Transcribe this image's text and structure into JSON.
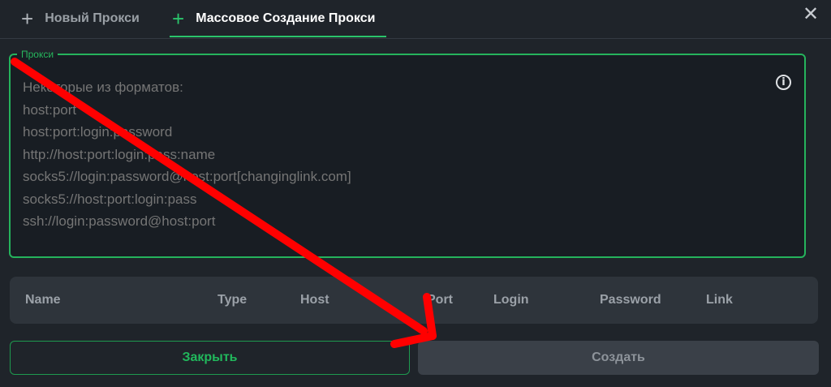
{
  "tabs": [
    {
      "label": "Новый Прокси",
      "icon": "plus-icon",
      "active": false
    },
    {
      "label": "Массовое Создание Прокси",
      "icon": "plus-icon",
      "active": true
    }
  ],
  "close_icon": "close-icon",
  "proxy_field": {
    "legend": "Прокси",
    "placeholder": "Некоторые из форматов:\nhost:port\nhost:port:login:password\nhttp://host:port:login:pass:name\nsocks5://login:password@host:port[changinglink.com]\nsocks5://host:port:login:pass\nssh://login:password@host:port",
    "value": "",
    "info_icon": "info-icon"
  },
  "table": {
    "columns": [
      "Name",
      "Type",
      "Host",
      "Port",
      "Login",
      "Password",
      "Link"
    ]
  },
  "buttons": {
    "close_label": "Закрыть",
    "create_label": "Создать"
  },
  "colors": {
    "accent": "#2bc46b",
    "background": "#1f242a",
    "annotation_arrow": "#ff0000"
  }
}
